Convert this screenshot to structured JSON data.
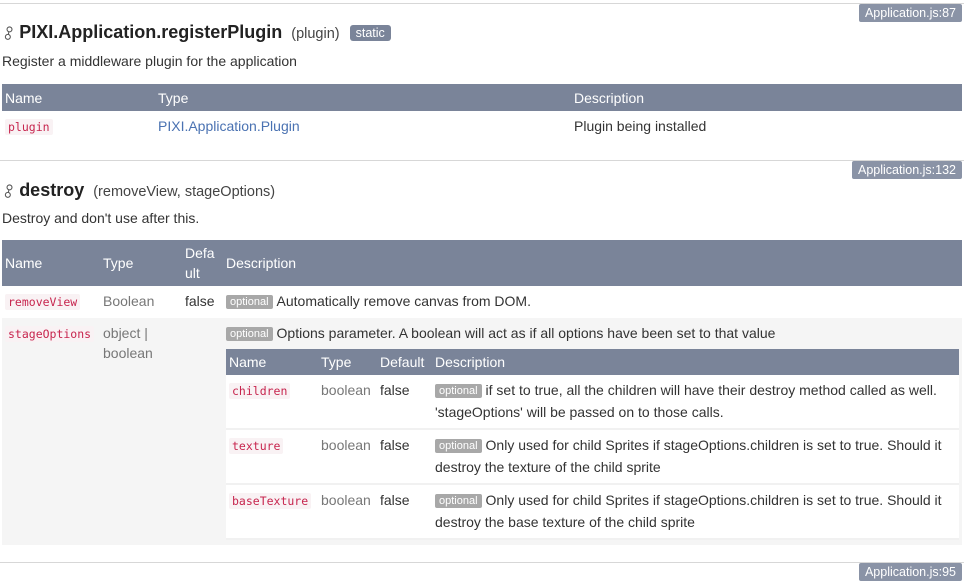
{
  "section1": {
    "source": "Application.js:87",
    "method": "PIXI.Application.registerPlugin",
    "params": "(plugin)",
    "badge": "static",
    "description": "Register a middleware plugin for the application",
    "table": {
      "headers": [
        "Name",
        "Type",
        "Description"
      ],
      "rows": [
        {
          "name": "plugin",
          "type": "PIXI.Application.Plugin",
          "description": "Plugin being installed"
        }
      ]
    }
  },
  "section2": {
    "source": "Application.js:132",
    "method": "destroy",
    "params": "(removeView, stageOptions)",
    "description": "Destroy and don't use after this.",
    "table": {
      "headers": [
        "Name",
        "Type",
        "Defa ult",
        "Description"
      ],
      "rows": [
        {
          "name": "removeView",
          "type": "Boolean",
          "default": "false",
          "optional": "optional",
          "description": "Automatically remove canvas from DOM."
        },
        {
          "name": "stageOptions",
          "type": "object | boolean",
          "default": "",
          "optional": "optional",
          "description": "Options parameter. A boolean will act as if all options have been set to that value"
        }
      ],
      "nested": {
        "headers": [
          "Name",
          "Type",
          "Default",
          "Description"
        ],
        "rows": [
          {
            "name": "children",
            "type": "boolean",
            "default": "false",
            "optional": "optional",
            "description": "if set to true, all the children will have their destroy method called as well. 'stageOptions' will be passed on to those calls."
          },
          {
            "name": "texture",
            "type": "boolean",
            "default": "false",
            "optional": "optional",
            "description": "Only used for child Sprites if stageOptions.children is set to true. Should it destroy the texture of the child sprite"
          },
          {
            "name": "baseTexture",
            "type": "boolean",
            "default": "false",
            "optional": "optional",
            "description": "Only used for child Sprites if stageOptions.children is set to true. Should it destroy the base texture of the child sprite"
          }
        ]
      }
    }
  },
  "section3": {
    "source": "Application.js:95"
  },
  "icons": {
    "link": "link-icon"
  },
  "colors": {
    "header_bg": "#7a8499",
    "badge_bg": "#8a93a6",
    "param_name": "#c7254e",
    "link": "#4a72b2",
    "optional_bg": "#a8a8a8"
  }
}
